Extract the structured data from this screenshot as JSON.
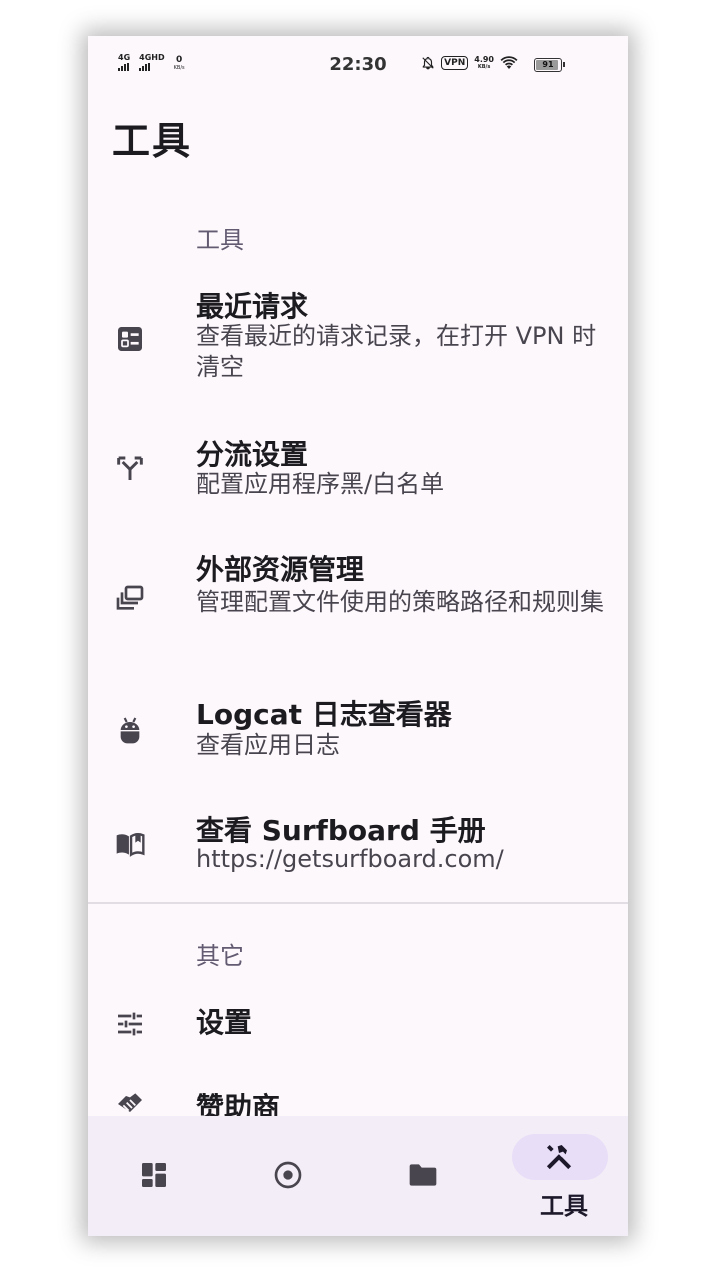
{
  "status_bar": {
    "sim1_label": "4G",
    "sim2_label": "4GHD",
    "speed_value": "0",
    "speed_unit": "KB/s",
    "time": "22:30",
    "vpn": "VPN",
    "net_speed_value": "4.90",
    "net_speed_unit": "KB/s",
    "battery_level": "91"
  },
  "page": {
    "title": "工具"
  },
  "sections": {
    "tools": {
      "header": "工具",
      "items": [
        {
          "title": "最近请求",
          "subtitle": "查看最近的请求记录，在打开 VPN 时清空",
          "icon": "request-list-icon"
        },
        {
          "title": "分流设置",
          "subtitle": "配置应用程序黑/白名单",
          "icon": "split-route-icon"
        },
        {
          "title": "外部资源管理",
          "subtitle": "管理配置文件使用的策略路径和规则集",
          "icon": "resources-icon"
        },
        {
          "title": "Logcat 日志查看器",
          "subtitle": "查看应用日志",
          "icon": "android-icon"
        },
        {
          "title": "查看 Surfboard 手册",
          "subtitle": "https://getsurfboard.com/",
          "icon": "book-icon"
        }
      ]
    },
    "other": {
      "header": "其它",
      "items": [
        {
          "title": "设置",
          "icon": "tune-icon"
        },
        {
          "title": "赞助商",
          "icon": "handshake-icon"
        }
      ]
    }
  },
  "bottom_nav": {
    "items": [
      {
        "icon": "dashboard-icon",
        "label": ""
      },
      {
        "icon": "radio-target-icon",
        "label": ""
      },
      {
        "icon": "folder-icon",
        "label": ""
      },
      {
        "icon": "tools-icon",
        "label": "工具",
        "active": true
      }
    ]
  },
  "colors": {
    "background": "#fdf8fc",
    "nav_background": "#f3edf7",
    "active_pill": "#e8def8",
    "icon": "#49454f",
    "text_primary": "#1c1b1f",
    "section_header": "#625b71"
  }
}
